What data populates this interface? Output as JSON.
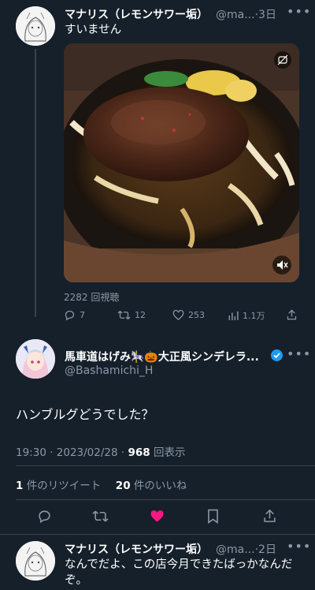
{
  "tweet1": {
    "name": "マナリス（レモンサワー垢）",
    "handle": "@ma...",
    "time": "3日",
    "text": "すいません",
    "views": "2282 回視聴",
    "replies": "7",
    "retweets": "12",
    "likes": "253",
    "analytics": "1.1万"
  },
  "tweet2": {
    "name": "馬車道はげみ🎠🎃大正風シンデレラ...",
    "handle": "@Bashamichi_H",
    "text": "ハンブルグどうでした？",
    "datetime": "19:30 · 2023/02/28 · ",
    "view_count": "968",
    "view_label": " 回表示",
    "retweet_count": "1",
    "retweet_label": " 件のリツイート",
    "like_count": "20",
    "like_label": " 件のいいね"
  },
  "tweet3": {
    "name": "マナリス（レモンサワー垢）",
    "handle": "@ma...",
    "time": "2日",
    "text": "なんでだよ、この店今月できたばっかなんだぞ。"
  },
  "colors": {
    "background": "#15202b",
    "muted": "#8b98a5",
    "like_active": "#f91880",
    "verified": "#1d9bf0"
  }
}
